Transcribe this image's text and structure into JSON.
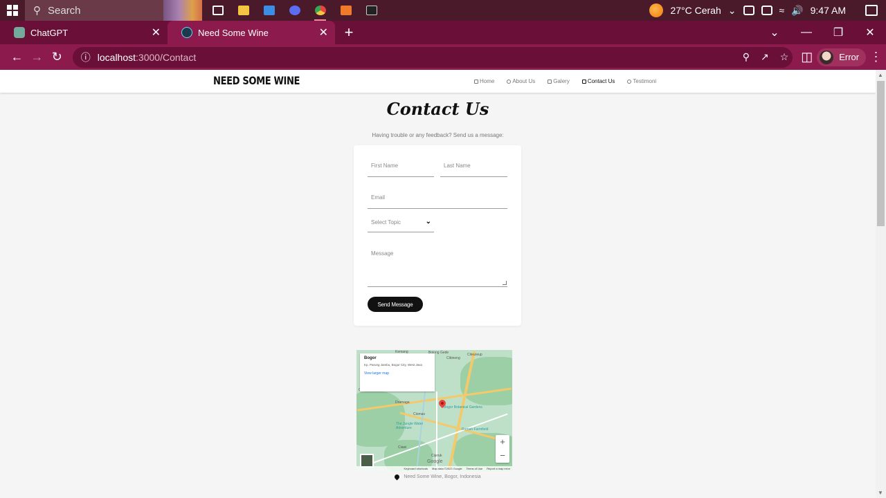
{
  "taskbar": {
    "search_label": "Search",
    "weather": "27°C  Cerah",
    "time": "9:47 AM",
    "apps": [
      {
        "name": "task-view",
        "color": "#ffffff"
      },
      {
        "name": "file-explorer",
        "color": "#f4c542"
      },
      {
        "name": "mail",
        "color": "#3a8ee6"
      },
      {
        "name": "media",
        "color": "#5b6df0"
      },
      {
        "name": "chrome",
        "color": "#e8453c"
      },
      {
        "name": "xampp",
        "color": "#f07a2c"
      },
      {
        "name": "terminal",
        "color": "#222222"
      }
    ]
  },
  "browser": {
    "tabs": [
      {
        "title": "ChatGPT",
        "active": false,
        "close": "✕"
      },
      {
        "title": "Need Some Wine",
        "active": true,
        "close": "✕"
      }
    ],
    "new_tab": "+",
    "url_host": "localhost",
    "url_path": ":3000/Contact",
    "profile_label": "Error"
  },
  "site": {
    "brand": "NEED SOME WINE",
    "menu": [
      "Home",
      "About Us",
      "Galery",
      "Contact Us",
      "Testimoni"
    ],
    "active_menu": "Contact Us"
  },
  "contact": {
    "title": "Contact Us",
    "subtitle": "Having trouble or any feedback? Send us a message:",
    "first_name_placeholder": "First Name",
    "last_name_placeholder": "Last Name",
    "email_placeholder": "Email",
    "topic_selected": "Select Topic",
    "message_placeholder": "Message",
    "send_label": "Send Message"
  },
  "map": {
    "place_name": "Bogor",
    "place_address": "Kp. Parung Jambu, Bogor City, West Java",
    "view_larger": "View larger map",
    "labels": [
      "Kemang",
      "Bojong Gede",
      "Cibinong",
      "Citeureup",
      "Dramaga",
      "Ciomas",
      "Bogor Botanical Gardens",
      "The Jungle Water Adventure",
      "Rumah Farmfield",
      "Cijeruk",
      "Ciampea",
      "Ciawi"
    ],
    "zoom_in": "+",
    "zoom_out": "−",
    "footer": [
      "Keyboard shortcuts",
      "Map data ©2023 Google",
      "Terms of Use",
      "Report a map error"
    ],
    "google": "Google"
  },
  "location_text": "Need Some Wine, Bogor, Indonesia"
}
